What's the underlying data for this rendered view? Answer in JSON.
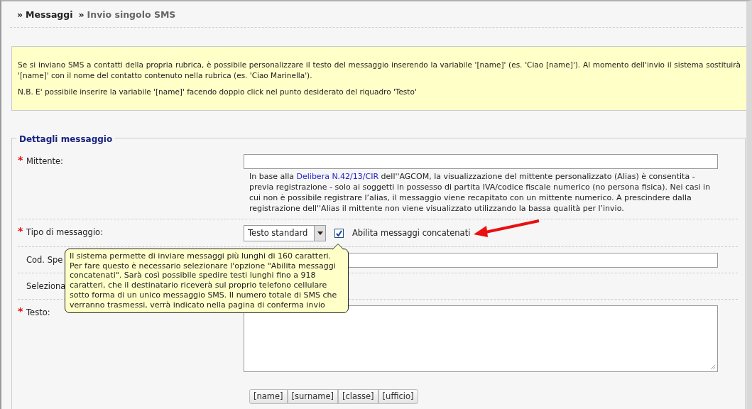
{
  "breadcrumb": [
    {
      "marker": "»",
      "text": "Messaggi",
      "current": false
    },
    {
      "marker": "»",
      "text": "Invio singolo SMS",
      "current": true
    }
  ],
  "info": {
    "paragraphs": [
      "Se si inviano SMS a contatti della propria rubrica, è possibile personalizzare il testo del messaggio inserendo la variabile '[name]' (es. 'Ciao [name]'). Al momento dell'invio il sistema sostituirà '[name]' con il nome del contatto contenuto nella rubrica (es. 'Ciao Marinella').",
      "N.B. E' possibile inserire la variabile '[name]' facendo doppio click nel punto desiderato del riquadro 'Testo'"
    ]
  },
  "form": {
    "legend": "Dettagli messaggio",
    "rows": [
      {
        "kind": "input",
        "mark": "*",
        "label": "Mittente:",
        "note": {
          "before": "In base alla ",
          "link": "Delibera N.42/13/CIR",
          "after": " dell''AGCOM, la visualizzazione del mittente personalizzato (Alias) è consentita - previa registrazione - solo ai soggetti in possesso di partita IVA/codice fiscale numerico (no persona fisica). Nei casi in cui non è possibile registrare l’alias, il messaggio viene recapitato con un mittente numerico. A prescindere dalla registrazione dell''Alias il mittente non viene visualizzato utilizzando la bassa qualità per l’invio."
        }
      },
      {
        "kind": "select",
        "mark": "*",
        "label": "Tipo di messaggio:",
        "value": "Testo standard",
        "checkbox": {
          "label": "Abilita messaggi concatenati",
          "checked": true
        }
      },
      {
        "kind": "input",
        "label": "Cod. Spe"
      },
      {
        "kind": "blank",
        "label": "Seleziona"
      },
      {
        "kind": "textarea",
        "mark": "*",
        "label": "Testo:",
        "buttons": [
          "[name]",
          "[surname]",
          "[classe]",
          "[ufficio]"
        ]
      }
    ]
  },
  "tooltip": {
    "text": "Il sistema permette di inviare messaggi più lunghi di 160 caratteri. Per fare questo è necessario selezionare l'opzione \"Abilita messaggi concatenati\". Sarà così possibile spedire testi lunghi fino a 918 caratteri, che il destinatario riceverà sul proprio telefono cellulare sotto forma di un unico messaggio SMS. Il numero totale di SMS che verranno trasmessi, verrà indicato nella pagina di conferma invio"
  }
}
